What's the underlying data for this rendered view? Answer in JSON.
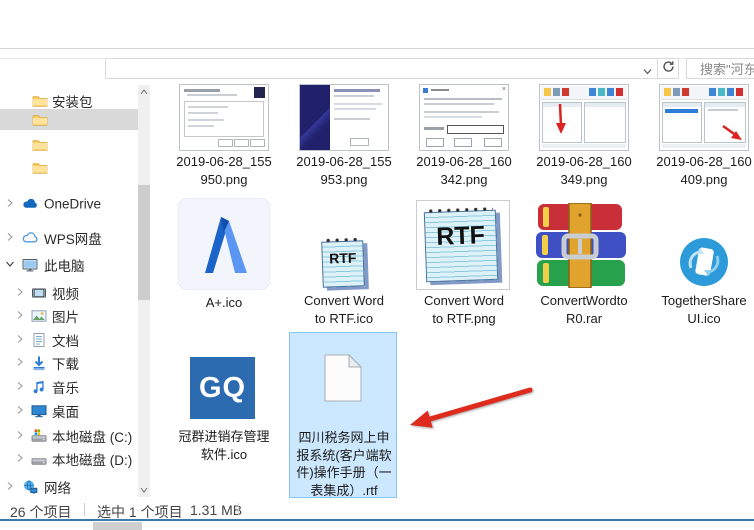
{
  "toolbar": {
    "search_placeholder": "搜索\"河东",
    "icons": {
      "address_dropdown": "chevron-down",
      "refresh": "refresh-circular-arrow",
      "search": "search-box"
    }
  },
  "sidebar": {
    "items": [
      {
        "label": "安装包",
        "icon": "folder",
        "level": "folder"
      },
      {
        "label": "",
        "icon": "folder",
        "level": "folder",
        "highlighted": true
      },
      {
        "label": "",
        "icon": "folder",
        "level": "folder"
      },
      {
        "label": "",
        "icon": "folder",
        "level": "folder"
      },
      {
        "label": "OneDrive",
        "icon": "onedrive-cloud",
        "chevron": "collapsed"
      },
      {
        "label": "WPS网盘",
        "icon": "wps-cloud-outline",
        "chevron": "collapsed"
      },
      {
        "label": "此电脑",
        "icon": "computer-monitor",
        "chevron": "expanded"
      },
      {
        "label": "视频",
        "icon": "videos-film",
        "chevron": "collapsed"
      },
      {
        "label": "图片",
        "icon": "pictures-image",
        "chevron": "collapsed"
      },
      {
        "label": "文档",
        "icon": "documents-page",
        "chevron": "collapsed"
      },
      {
        "label": "下载",
        "icon": "downloads-arrow",
        "chevron": "collapsed"
      },
      {
        "label": "音乐",
        "icon": "music-note",
        "chevron": "collapsed"
      },
      {
        "label": "桌面",
        "icon": "desktop-monitor",
        "chevron": "collapsed"
      },
      {
        "label": "本地磁盘 (C:)",
        "icon": "hard-drive-windows",
        "chevron": "collapsed"
      },
      {
        "label": "本地磁盘 (D:)",
        "icon": "hard-drive",
        "chevron": "collapsed"
      },
      {
        "label": "网络",
        "icon": "network-globe-computer",
        "chevron": "collapsed"
      }
    ]
  },
  "files": [
    {
      "label_lines": [
        "2019-06-28_155",
        "950.png"
      ],
      "icon": "setup-ready-dialog-screenshot"
    },
    {
      "label_lines": [
        "2019-06-28_155",
        "953.png"
      ],
      "icon": "setup-finish-dialog-screenshot"
    },
    {
      "label_lines": [
        "2019-06-28_160",
        "342.png"
      ],
      "icon": "register-dialog-screenshot"
    },
    {
      "label_lines": [
        "2019-06-28_160",
        "349.png"
      ],
      "icon": "converter-app-screenshot"
    },
    {
      "label_lines": [
        "2019-06-28_160",
        "409.png"
      ],
      "icon": "converter-app-selected-screenshot"
    },
    {
      "label_lines": [
        "A+.ico"
      ],
      "icon": "a-plus-blue-logo"
    },
    {
      "label_lines": [
        "Convert Word",
        "to RTF.ico"
      ],
      "icon": "rtf-notepad-small",
      "icon_text": "RTF"
    },
    {
      "label_lines": [
        "Convert Word",
        "to RTF.png"
      ],
      "icon": "rtf-notepad-large",
      "icon_text": "RTF"
    },
    {
      "label_lines": [
        "ConvertWordto",
        "R0.rar"
      ],
      "icon": "winrar-archive"
    },
    {
      "label_lines": [
        "TogetherShare",
        "UI.ico"
      ],
      "icon": "togethershare-phone-circle"
    },
    {
      "label_lines": [
        "冠群进销存管理",
        "软件.ico"
      ],
      "icon": "gq-blue-square",
      "icon_text": "GQ"
    },
    {
      "label_lines": [
        "四川税务网上申",
        "报系统(客户端软",
        "件)操作手册（一",
        "表集成）.rtf"
      ],
      "icon": "blank-document",
      "selected": true
    }
  ],
  "status_bar": {
    "item_count": "26 个项目",
    "selected_count": "选中 1 个项目",
    "selected_size": "1.31 MB"
  },
  "annotations": {
    "red_arrow": "points-to-selected-rtf-file"
  },
  "colors": {
    "selection_fill": "#cce8ff",
    "selection_border": "#84c5f2",
    "sidebar_selected_row": "#d9d9d9",
    "window_bottom_border": "#3a7ca9",
    "red_arrow": "#df2b1d"
  }
}
